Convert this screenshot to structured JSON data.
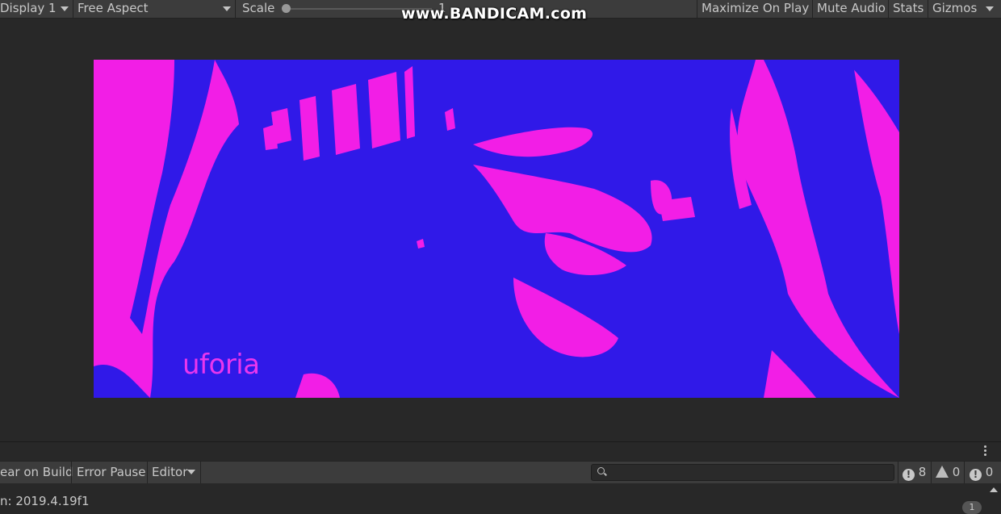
{
  "toolbar": {
    "display": "Display 1",
    "aspect": "Free Aspect",
    "scale_label": "Scale",
    "scale_value": "1",
    "maximize": "Maximize On Play",
    "mute": "Mute Audio",
    "stats": "Stats",
    "gizmos": "Gizmos"
  },
  "watermark": "www.BANDICAM.com",
  "game_view": {
    "logo_text": "uforia",
    "colors": {
      "background": "#f21ee6",
      "foreground": "#3019e8"
    }
  },
  "console": {
    "clear_on_build": "ear on Build",
    "error_pause": "Error Pause",
    "editor": "Editor",
    "search_placeholder": "",
    "counts": {
      "messages": "8",
      "warnings": "0",
      "errors": "0"
    },
    "status": "n: 2019.4.19f1",
    "badge": "1"
  },
  "icons": [
    "dropdown-arrow-icon",
    "search-icon",
    "info-icon",
    "warning-icon",
    "error-icon",
    "kebab-menu-icon"
  ]
}
